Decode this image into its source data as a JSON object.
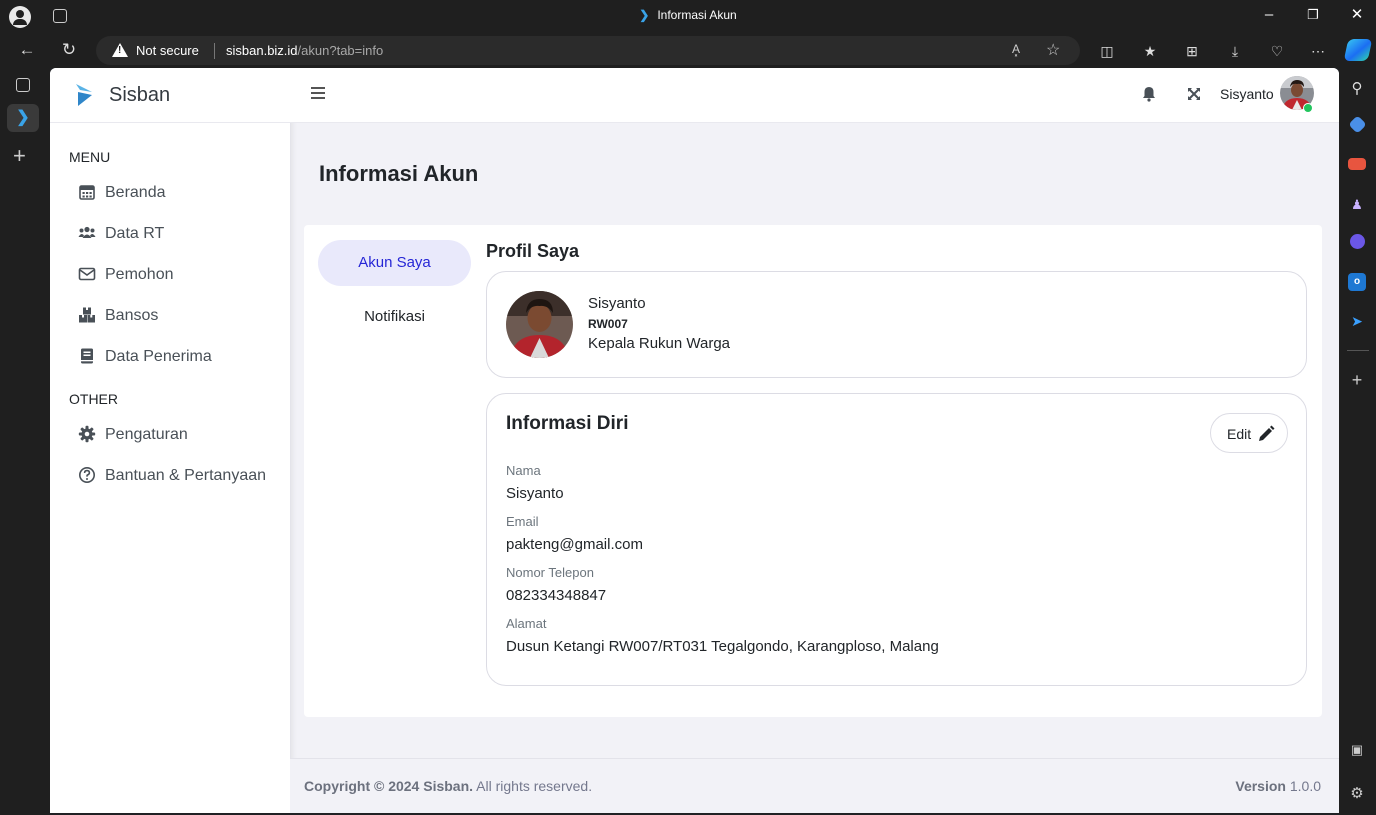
{
  "browser": {
    "tab_title": "Informasi Akun",
    "security_label": "Not secure",
    "url_host": "sisban.biz.id",
    "url_path": "/akun?tab=info",
    "read_aloud_label": "A͓"
  },
  "app": {
    "brand": "Sisban"
  },
  "sidebar": {
    "menu_title": "MENU",
    "other_title": "OTHER",
    "items": [
      {
        "label": "Beranda",
        "icon": "calendar-icon"
      },
      {
        "label": "Data RT",
        "icon": "users-icon"
      },
      {
        "label": "Pemohon",
        "icon": "envelope-icon"
      },
      {
        "label": "Bansos",
        "icon": "boxes-icon"
      },
      {
        "label": "Data Penerima",
        "icon": "book-icon"
      },
      {
        "label": "Pengaturan",
        "icon": "gear-icon"
      },
      {
        "label": "Bantuan & Pertanyaan",
        "icon": "question-circle-icon"
      }
    ]
  },
  "topbar": {
    "username": "Sisyanto"
  },
  "page": {
    "title": "Informasi Akun",
    "tabs": [
      {
        "label": "Akun Saya",
        "active": true
      },
      {
        "label": "Notifikasi",
        "active": false
      }
    ],
    "section_title": "Profil Saya",
    "profile": {
      "name": "Sisyanto",
      "code": "RW007",
      "role": "Kepala Rukun Warga"
    },
    "info": {
      "title": "Informasi Diri",
      "edit_label": "Edit",
      "fields": [
        {
          "label": "Nama",
          "value": "Sisyanto"
        },
        {
          "label": "Email",
          "value": "pakteng@gmail.com"
        },
        {
          "label": "Nomor Telepon",
          "value": "082334348847"
        },
        {
          "label": "Alamat",
          "value": "Dusun Ketangi RW007/RT031 Tegalgondo, Karangploso, Malang"
        }
      ]
    }
  },
  "footer": {
    "copyright_prefix": "Copyright © 2024 Sisban.",
    "copyright_suffix": " All rights reserved.",
    "version_label": "Version",
    "version_value": " 1.0.0"
  },
  "colors": {
    "accent": "#2626d6",
    "active_tab_bg": "#e9e9fb",
    "online": "#22c55e"
  }
}
